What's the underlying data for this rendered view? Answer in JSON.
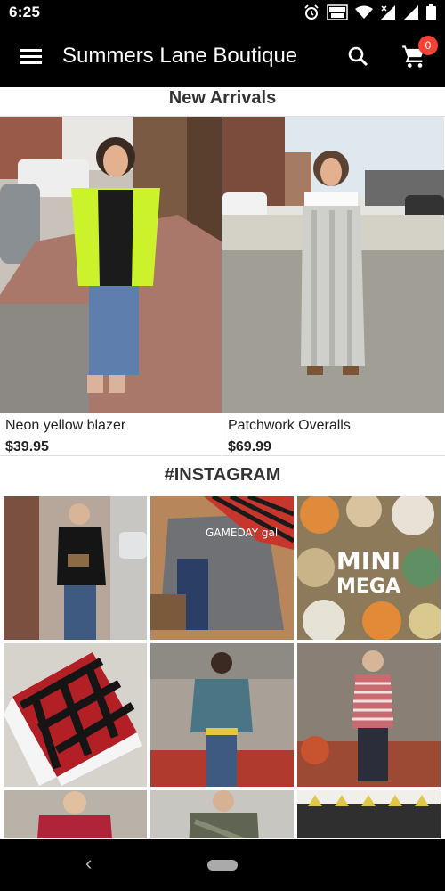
{
  "status": {
    "time": "6:25"
  },
  "app_bar": {
    "title": "Summers Lane Boutique",
    "cart_count": "0"
  },
  "sections": {
    "new_arrivals": "New Arrivals",
    "instagram": "#INSTAGRAM"
  },
  "products": [
    {
      "name": "Neon yellow blazer",
      "price": "$39.95"
    },
    {
      "name": "Patchwork Overalls",
      "price": "$69.99"
    }
  ],
  "instagram_tiles": [
    {
      "kind": "photo"
    },
    {
      "kind": "photo",
      "text": "GAMEDAY gal"
    },
    {
      "kind": "photo",
      "text_top": "MINI",
      "text_bottom": "MEGA"
    },
    {
      "kind": "photo"
    },
    {
      "kind": "photo"
    },
    {
      "kind": "photo"
    },
    {
      "kind": "photo"
    },
    {
      "kind": "photo"
    },
    {
      "kind": "photo"
    }
  ],
  "colors": {
    "bar": "#000000",
    "badge": "#f44336",
    "heading": "#333333"
  }
}
